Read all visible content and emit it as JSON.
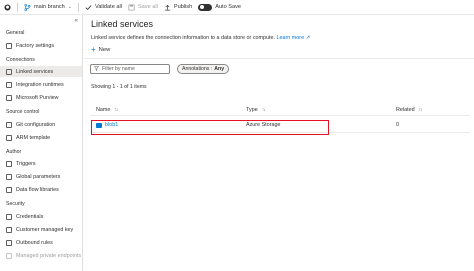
{
  "toolbar": {
    "branch": "main branch",
    "validate_all": "Validate all",
    "save_all": "Save all",
    "publish": "Publish",
    "auto_save": "Auto Save"
  },
  "sidebar": {
    "sections": [
      {
        "title": "General",
        "items": [
          {
            "label": "Factory settings"
          }
        ]
      },
      {
        "title": "Connections",
        "items": [
          {
            "label": "Linked services"
          },
          {
            "label": "Integration runtimes"
          },
          {
            "label": "Microsoft Purview"
          }
        ]
      },
      {
        "title": "Source control",
        "items": [
          {
            "label": "Git configuration"
          },
          {
            "label": "ARM template"
          }
        ]
      },
      {
        "title": "Author",
        "items": [
          {
            "label": "Triggers"
          },
          {
            "label": "Global parameters"
          },
          {
            "label": "Data flow libraries"
          }
        ]
      },
      {
        "title": "Security",
        "items": [
          {
            "label": "Credentials"
          },
          {
            "label": "Customer managed key"
          },
          {
            "label": "Outbound rules"
          },
          {
            "label": "Managed private endpoints"
          }
        ]
      }
    ]
  },
  "main": {
    "title": "Linked services",
    "description": "Linked service defines the connection information to a data store or compute.",
    "learn_more": "Learn more",
    "new_label": "New",
    "filter_placeholder": "Filter by name",
    "annotations_label": "Annotations :",
    "annotations_value": "Any",
    "showing": "Showing 1 - 1 of 1 items",
    "columns": {
      "name": "Name",
      "type": "Type",
      "related": "Related"
    },
    "rows": [
      {
        "name": "blob1",
        "type": "Azure Storage",
        "related": "0"
      }
    ]
  }
}
